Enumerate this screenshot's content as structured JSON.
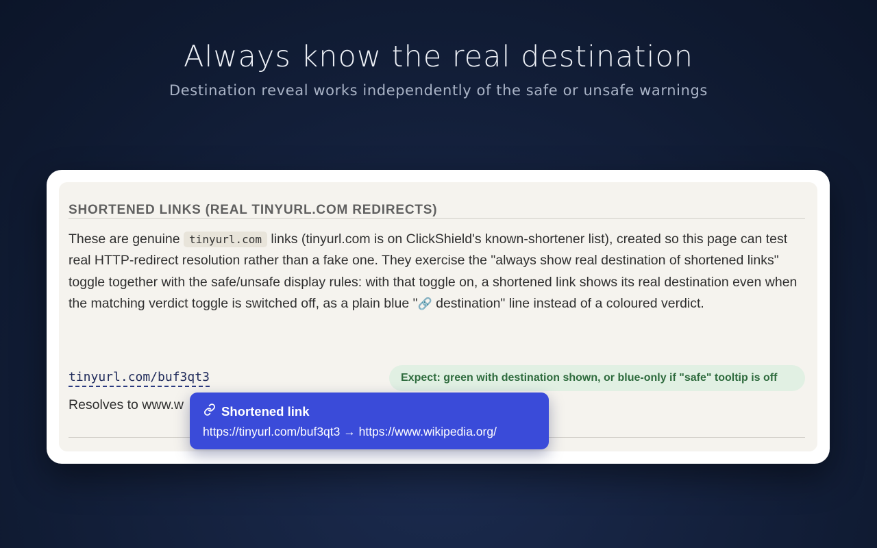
{
  "hero": {
    "title": "Always know the real destination",
    "subtitle": "Destination reveal works independently of the safe or unsafe warnings"
  },
  "section": {
    "heading": "SHORTENED LINKS (REAL TINYURL.COM REDIRECTS)",
    "description_part1": "These are genuine ",
    "code_chip": "tinyurl.com",
    "description_part2": " links (tinyurl.com is on ClickShield's known-shortener list), created so this page can test real HTTP-redirect resolution rather than a fake one. They exercise the \"always show real destination of shortened links\" toggle together with the safe/unsafe display rules: with that toggle on, a shortened link shows its real destination even when the matching verdict toggle is switched off, as a plain blue \"",
    "inline_icon": "link-icon",
    "description_part3": " destination\" line instead of a coloured verdict."
  },
  "example": {
    "link_text": "tinyurl.com/buf3qt3",
    "expect_badge": "Expect: green with destination shown, or blue-only if \"safe\" tooltip is off",
    "resolves_text": "Resolves to www.w"
  },
  "tooltip": {
    "icon": "link-icon",
    "title": "Shortened link",
    "url_line": "https://tinyurl.com/buf3qt3 → https://www.wikipedia.org/"
  },
  "colors": {
    "tooltip_bg": "#3a4bd9",
    "badge_bg": "#e1f0e3",
    "badge_text": "#2e6b3d",
    "card_bg": "#f5f3ee"
  }
}
